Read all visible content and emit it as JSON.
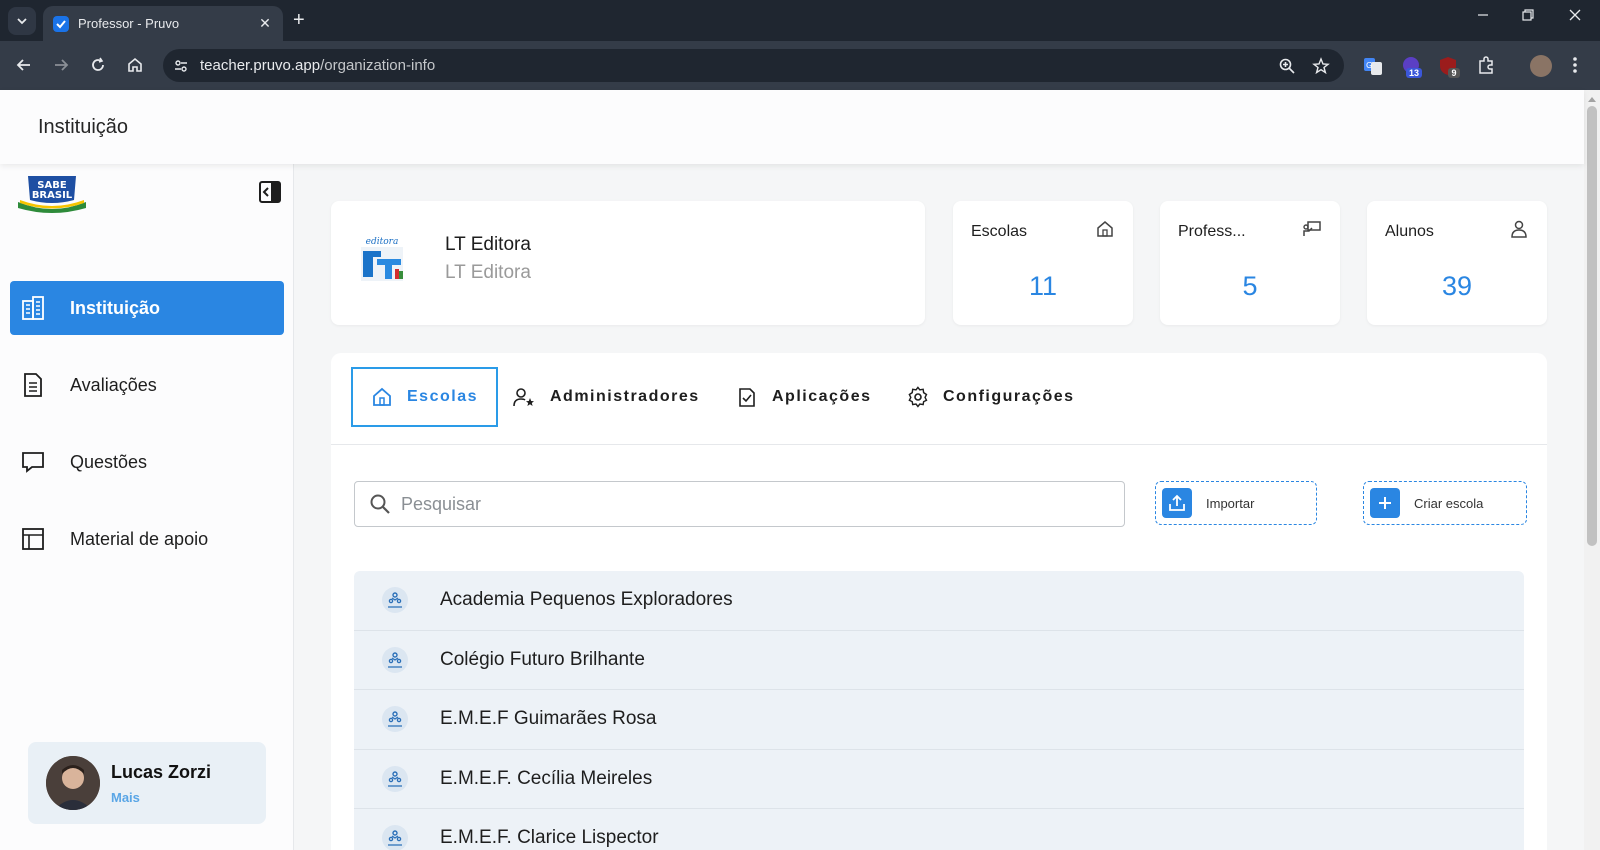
{
  "browser": {
    "tab_title": "Professor - Pruvo",
    "url_host": "teacher.pruvo.app",
    "url_path": "/organization-info",
    "ext_badges": [
      "13",
      "9"
    ]
  },
  "header": {
    "title": "Instituição"
  },
  "sidebar": {
    "logo_text": [
      "SABE",
      "BRASIL"
    ],
    "items": [
      {
        "label": "Instituição",
        "icon": "building-icon",
        "active": true
      },
      {
        "label": "Avaliações",
        "icon": "document-icon"
      },
      {
        "label": "Questões",
        "icon": "chat-icon"
      },
      {
        "label": "Material de apoio",
        "icon": "layout-icon"
      }
    ],
    "user": {
      "name": "Lucas Zorzi",
      "more": "Mais"
    }
  },
  "org": {
    "name": "LT Editora",
    "subtitle": "LT Editora",
    "logo_text": "editora"
  },
  "stats": [
    {
      "label": "Escolas",
      "value": "11",
      "icon": "home-icon"
    },
    {
      "label": "Profess...",
      "value": "5",
      "icon": "teacher-icon"
    },
    {
      "label": "Alunos",
      "value": "39",
      "icon": "person-icon"
    }
  ],
  "tabs": [
    {
      "label": "Escolas",
      "icon": "home-icon",
      "active": true
    },
    {
      "label": "Administradores",
      "icon": "user-star-icon"
    },
    {
      "label": "Aplicações",
      "icon": "clipboard-check-icon"
    },
    {
      "label": "Configurações",
      "icon": "gear-icon"
    }
  ],
  "search": {
    "placeholder": "Pesquisar"
  },
  "actions": {
    "import_label": "Importar",
    "create_label": "Criar escola"
  },
  "schools": [
    "Academia Pequenos Exploradores",
    "Colégio Futuro Brilhante",
    "E.M.E.F Guimarães Rosa",
    "E.M.E.F. Cecília Meireles",
    "E.M.E.F. Clarice Lispector"
  ],
  "colors": {
    "accent": "#2a86e2",
    "chrome": "#1f2630",
    "row_bg": "#edf2f7"
  }
}
